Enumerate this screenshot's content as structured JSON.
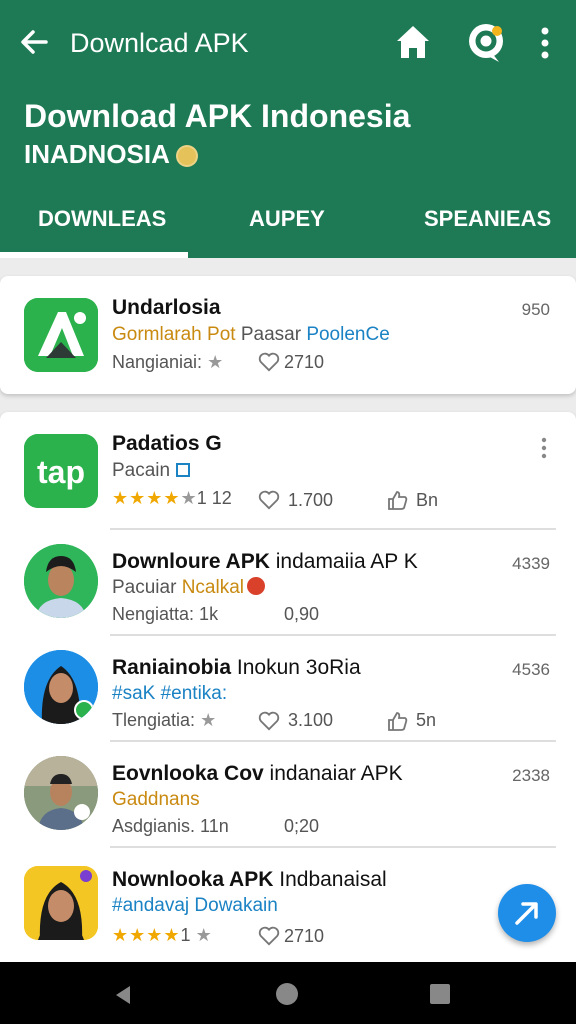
{
  "appbar": {
    "title": "Downlcad APK",
    "icons": [
      "back-icon",
      "home-icon",
      "chat-icon",
      "more-icon"
    ]
  },
  "header": {
    "title": "Download APK Indonesia",
    "subtitle": "INADNOSIA"
  },
  "tabs": [
    {
      "label": "DOWNLEAS",
      "selected": true
    },
    {
      "label": "AUPEY",
      "selected": false
    },
    {
      "label": "SPEANIEAS",
      "selected": false
    }
  ],
  "items": [
    {
      "name": "Undarlosia",
      "count": "950",
      "sub_gold": "Gormlarah Pot",
      "sub_grey": "Paasar",
      "sub_blue": "PoolenCe",
      "meta_label": "Nangianiai:",
      "likes": "2710"
    },
    {
      "name": "Padatios G",
      "sub_grey": "Pacain",
      "rating": "1 12",
      "likes": "1.700",
      "thumbs": "Bn"
    },
    {
      "name": "Downloure APK",
      "name_light": "indamaiia AP K",
      "count": "4339",
      "sub_grey": "Pacuiar",
      "sub_gold": "Ncalkal",
      "meta_label": "Nengiatta: 1k",
      "meta_value": "0,90"
    },
    {
      "name": "Raniainobia",
      "name_light": "Inokun 3oRia",
      "count": "4536",
      "sub_blue": "#saK",
      "sub_blue2": "#entika:",
      "meta_label": "Tlengiatia:",
      "likes": "3.100",
      "thumbs": "5n"
    },
    {
      "name": "Eovnlooka Cov",
      "name_light": "indanaiar APK",
      "count": "2338",
      "sub_gold": "Gaddnans",
      "meta_label": "Asdgianis. 11n",
      "meta_value": "0;20"
    },
    {
      "name": "Nownlooka APK",
      "name_light": "Indbanaisal",
      "sub_blue": "#andavaj",
      "sub_blue2": "Dowakain",
      "rating": "1",
      "likes": "2710"
    }
  ],
  "colors": {
    "header_green": "#1e7a55",
    "accent_blue": "#1f8ee8",
    "star_gold": "#f0a800"
  }
}
